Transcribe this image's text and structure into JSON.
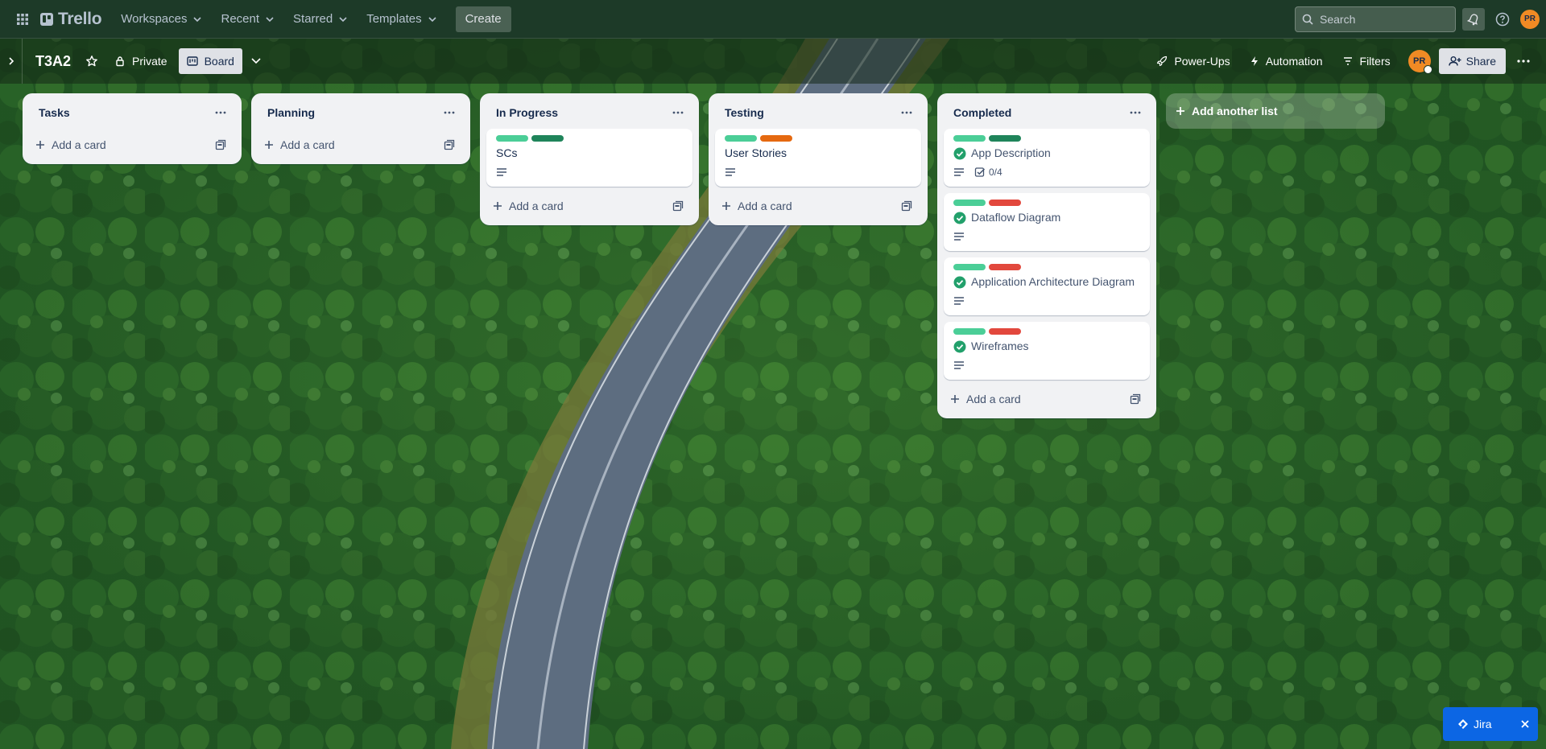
{
  "topnav": {
    "apps_icon": "grid-icon",
    "logo_text": "Trello",
    "menus": [
      "Workspaces",
      "Recent",
      "Starred",
      "Templates"
    ],
    "create_label": "Create",
    "search_placeholder": "Search",
    "avatar_initials": "PR"
  },
  "board": {
    "title": "T3A2",
    "visibility_label": "Private",
    "view_label": "Board",
    "powerups_label": "Power-Ups",
    "automation_label": "Automation",
    "filters_label": "Filters",
    "member_initials": "PR",
    "share_label": "Share",
    "add_list_label": "Add another list"
  },
  "colors": {
    "label_green": "#4bce97",
    "label_dark_green": "#1f845a",
    "label_orange": "#e56910",
    "label_red": "#e2483d",
    "check_green": "#22a06b",
    "avatar_orange": "#f08a24"
  },
  "lists": [
    {
      "title": "Tasks",
      "add_card_label": "Add a card"
    },
    {
      "title": "Planning",
      "add_card_label": "Add a card"
    },
    {
      "title": "In Progress",
      "add_card_label": "Add a card",
      "cards": [
        {
          "title": "SCs"
        }
      ]
    },
    {
      "title": "Testing",
      "add_card_label": "Add a card",
      "cards": [
        {
          "title": "User Stories"
        }
      ]
    },
    {
      "title": "Completed",
      "add_card_label": "Add a card",
      "cards": [
        {
          "title": "App Description",
          "checklist": "0/4"
        },
        {
          "title": "Dataflow Diagram"
        },
        {
          "title": "Application Architecture Diagram"
        },
        {
          "title": "Wireframes"
        }
      ]
    }
  ],
  "jira": {
    "label": "Jira"
  }
}
